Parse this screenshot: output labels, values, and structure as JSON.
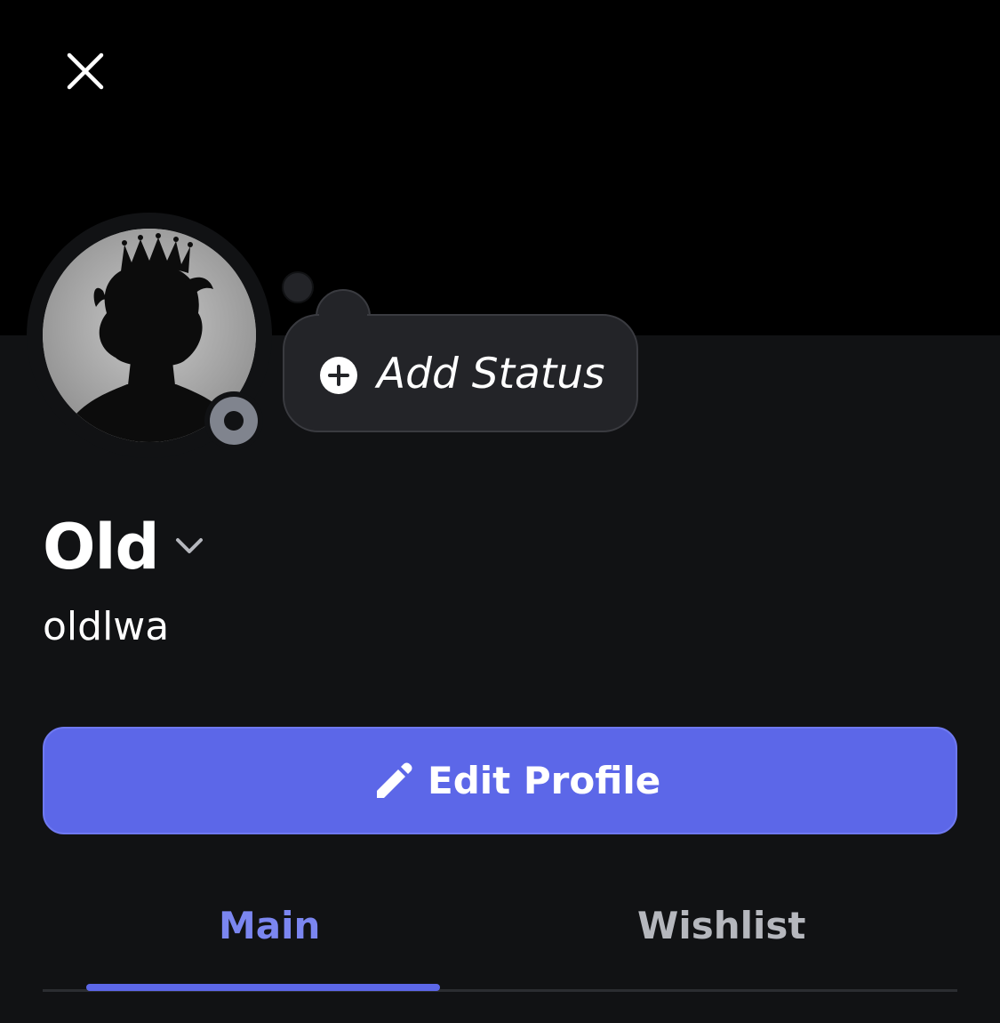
{
  "header": {
    "close_icon": "close-icon"
  },
  "profile": {
    "avatar_icon": "avatar-crown-silhouette",
    "presence_status": "offline",
    "presence_color": "#80848e",
    "status_bubble": {
      "icon": "plus-circle-icon",
      "label": "Add Status"
    },
    "display_name": "Old",
    "username": "oldlwa"
  },
  "actions": {
    "edit_profile_label": "Edit Profile",
    "edit_profile_icon": "pencil-icon",
    "accent_color": "#5c67e8"
  },
  "tabs": [
    {
      "label": "Main",
      "active": true
    },
    {
      "label": "Wishlist",
      "active": false
    }
  ]
}
